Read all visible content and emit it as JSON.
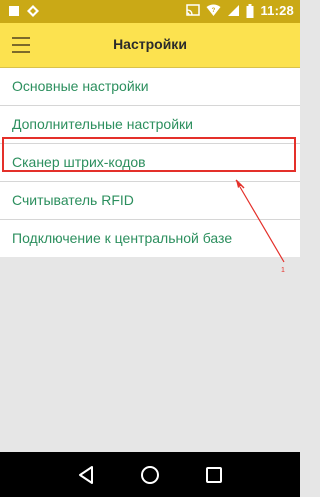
{
  "status_bar": {
    "time": "11:28",
    "left_icons": [
      "notification-square-icon",
      "diamond-app-icon"
    ],
    "right_icons": [
      "cast-icon",
      "wifi-icon",
      "signal-icon",
      "battery-icon"
    ]
  },
  "app_bar": {
    "title": "Настройки",
    "menu_icon": "hamburger-menu-icon"
  },
  "settings": {
    "items": [
      {
        "label": "Основные настройки"
      },
      {
        "label": "Дополнительные настройки"
      },
      {
        "label": "Сканер штрих-кодов"
      },
      {
        "label": "Считыватель RFID"
      },
      {
        "label": "Подключение к центральной базе"
      }
    ]
  },
  "annotation": {
    "label": "1",
    "color": "#e4302a"
  },
  "colors": {
    "status_bar": "#caa916",
    "app_bar": "#fce24f",
    "item_text": "#2c8f5e",
    "background": "#e6e6e6",
    "nav_bar": "#000000"
  },
  "nav_bar": {
    "buttons": [
      "back-icon",
      "home-icon",
      "recents-icon"
    ]
  }
}
